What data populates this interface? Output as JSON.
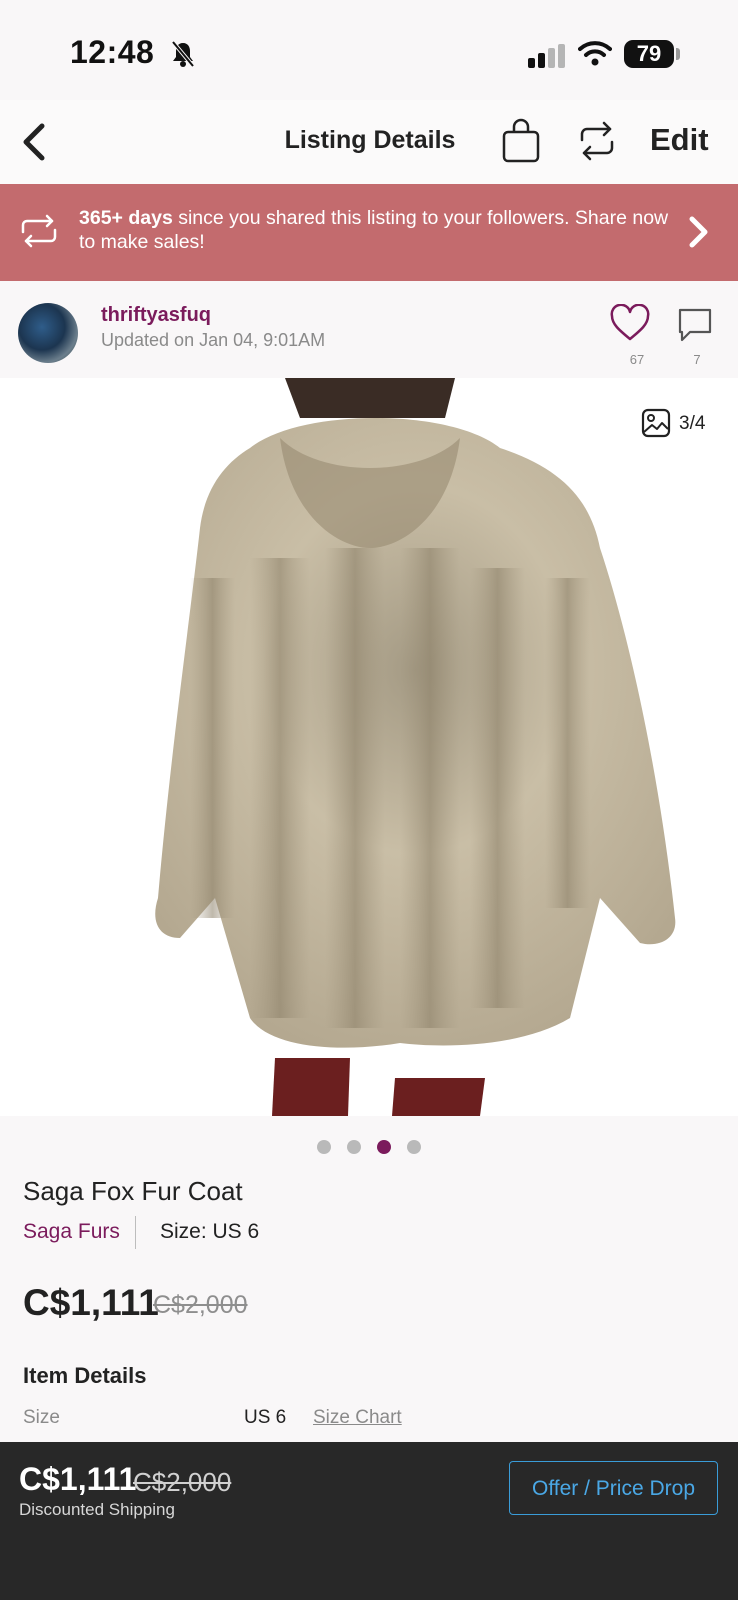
{
  "status_bar": {
    "time": "12:48",
    "battery": "79"
  },
  "header": {
    "title": "Listing Details",
    "edit_label": "Edit"
  },
  "banner": {
    "bold_text": "365+ days",
    "text": " since you shared this listing to your followers. Share now to make sales!"
  },
  "seller": {
    "username": "thriftyasfuq",
    "updated": "Updated on Jan 04, 9:01AM",
    "likes": "67",
    "comments": "7"
  },
  "photo": {
    "counter": "3/4",
    "dots_total": 4,
    "active_dot": 3
  },
  "item": {
    "title": "Saga Fox Fur Coat",
    "brand": "Saga Furs",
    "size_label": "Size: US 6",
    "price": "C$1,111",
    "original_price": "C$2,000"
  },
  "item_details": {
    "title": "Item Details",
    "size_label": "Size",
    "size_value": "US 6",
    "size_chart_link": "Size Chart"
  },
  "bottom_bar": {
    "price": "C$1,111",
    "original_price": "C$2,000",
    "shipping": "Discounted Shipping",
    "offer_button": "Offer / Price Drop"
  }
}
